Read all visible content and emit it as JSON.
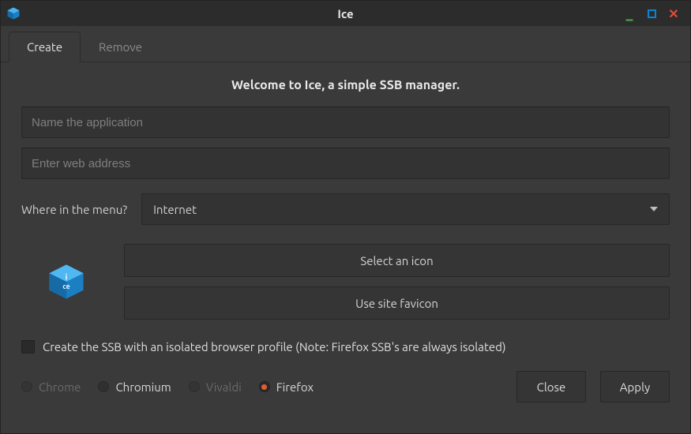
{
  "window": {
    "title": "Ice"
  },
  "tabs": {
    "create": "Create",
    "remove": "Remove"
  },
  "welcome": "Welcome to Ice, a simple SSB manager.",
  "inputs": {
    "name_placeholder": "Name the application",
    "name_value": "",
    "url_placeholder": "Enter web address",
    "url_value": ""
  },
  "menu": {
    "label": "Where in the menu?",
    "selected": "Internet"
  },
  "icon_buttons": {
    "select": "Select an icon",
    "favicon": "Use site favicon"
  },
  "isolated_checkbox": {
    "label": "Create the SSB with an isolated browser profile (Note: Firefox SSB's are always isolated)",
    "checked": false
  },
  "browsers": {
    "chrome": "Chrome",
    "chromium": "Chromium",
    "vivaldi": "Vivaldi",
    "firefox": "Firefox",
    "selected": "firefox"
  },
  "actions": {
    "close": "Close",
    "apply": "Apply"
  }
}
